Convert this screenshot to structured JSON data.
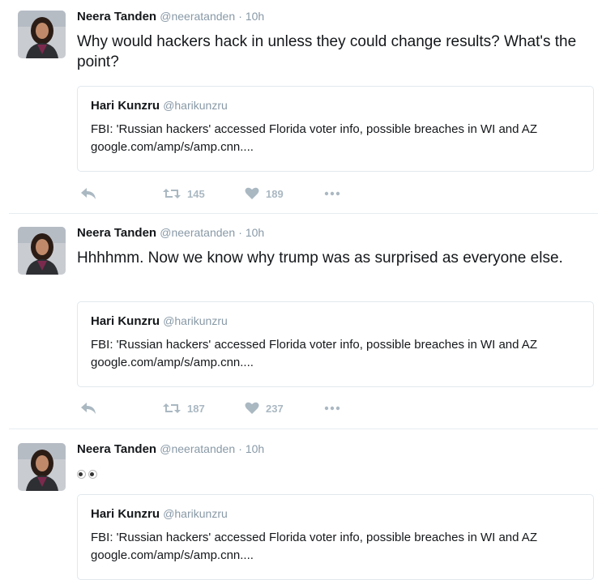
{
  "tweets": [
    {
      "name": "Neera Tanden",
      "handle": "@neeratanden",
      "time": "· 10h",
      "text": "Why would hackers hack in unless they could change results? What's the point?",
      "quote": {
        "name": "Hari Kunzru",
        "handle": "@harikunzru",
        "text": "FBI: 'Russian hackers' accessed Florida voter info, possible breaches in WI and AZ  google.com/amp/s/amp.cnn...."
      },
      "retweets": "145",
      "likes": "189"
    },
    {
      "name": "Neera Tanden",
      "handle": "@neeratanden",
      "time": "· 10h",
      "text": "Hhhhmm. Now we know why trump was as surprised as everyone else.",
      "quote": {
        "name": "Hari Kunzru",
        "handle": "@harikunzru",
        "text": "FBI: 'Russian hackers' accessed Florida voter info, possible breaches in WI and AZ  google.com/amp/s/amp.cnn...."
      },
      "retweets": "187",
      "likes": "237"
    },
    {
      "name": "Neera Tanden",
      "handle": "@neeratanden",
      "time": "· 10h",
      "text": "",
      "emoji": "eyes",
      "quote": {
        "name": "Hari Kunzru",
        "handle": "@harikunzru",
        "text": "FBI: 'Russian hackers' accessed Florida voter info, possible breaches in WI and AZ  google.com/amp/s/amp.cnn...."
      }
    }
  ],
  "colors": {
    "text": "#14171a",
    "muted": "#8899a6",
    "icon": "#aab8c2",
    "border": "#e1e8ed"
  },
  "icons": {
    "reply": "reply-icon",
    "retweet": "retweet-icon",
    "like": "heart-icon",
    "more": "more-icon"
  }
}
